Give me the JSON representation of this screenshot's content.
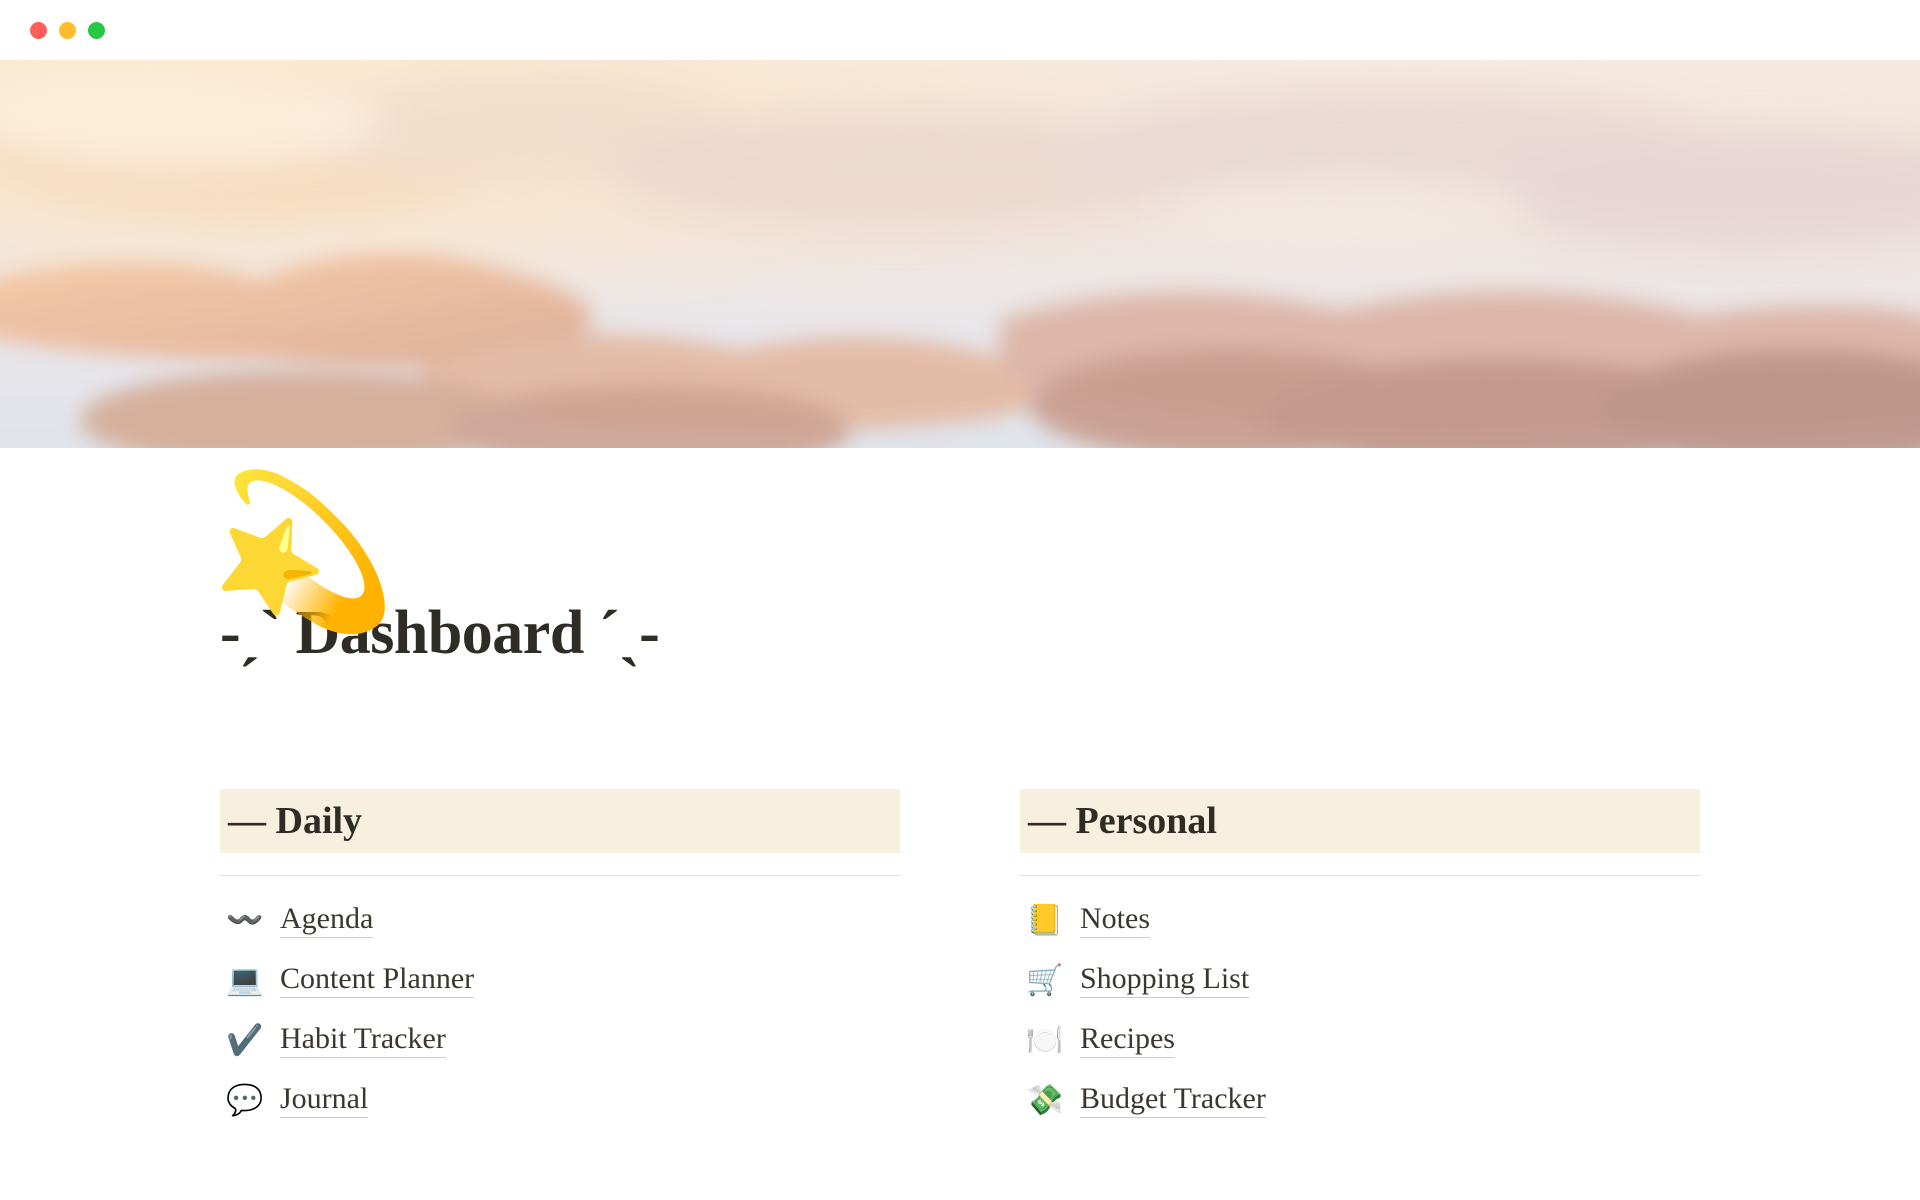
{
  "page": {
    "icon": "💫",
    "title": "-ˏˋ Dashboard ˊˎ-"
  },
  "sections": [
    {
      "heading": "— Daily",
      "links": [
        {
          "emoji": "〰️",
          "label": "Agenda"
        },
        {
          "emoji": "💻",
          "label": "Content Planner"
        },
        {
          "emoji": "✔️",
          "label": "Habit Tracker"
        },
        {
          "emoji": "💬",
          "label": "Journal"
        }
      ]
    },
    {
      "heading": "— Personal",
      "links": [
        {
          "emoji": "📒",
          "label": "Notes"
        },
        {
          "emoji": "🛒",
          "label": "Shopping List"
        },
        {
          "emoji": "🍽️",
          "label": "Recipes"
        },
        {
          "emoji": "💸",
          "label": "Budget Tracker"
        }
      ]
    }
  ]
}
